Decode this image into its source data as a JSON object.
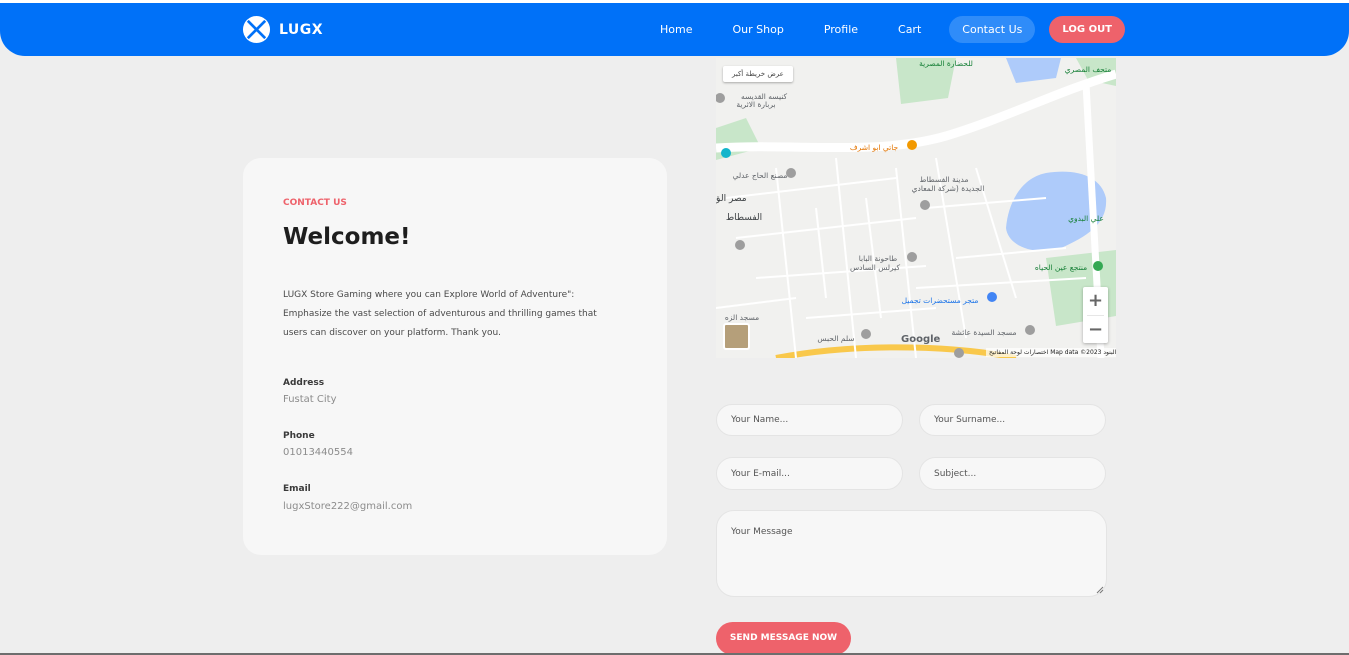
{
  "header": {
    "brand": "LUGX",
    "nav": [
      {
        "label": "Home"
      },
      {
        "label": "Our Shop"
      },
      {
        "label": "Profile"
      },
      {
        "label": "Cart"
      },
      {
        "label": "Contact Us"
      }
    ],
    "logout_label": "LOG OUT"
  },
  "contact": {
    "eyebrow": "CONTACT US",
    "title": "Welcome!",
    "description": "LUGX Store Gaming where you can Explore World of Adventure\": Emphasize the vast selection of adventurous and thrilling games that users can discover on your platform. Thank you.",
    "address_label": "Address",
    "address_value": "Fustat City",
    "phone_label": "Phone",
    "phone_value": "01013440554",
    "email_label": "Email",
    "email_value": "lugxStore222@gmail.com"
  },
  "map": {
    "view_larger": "عرض خريطة أكبر",
    "zoom_in": "+",
    "zoom_out": "−",
    "google": "Google",
    "credit": "اختصارات لوحة المفاتيح   Map data ©2023   البنود",
    "labels": [
      "مدينة الفسطاط",
      "الجديدة (شركة المعادي",
      "طاحونة البابا",
      "كيرلس السادس",
      "متجر مستحضرات تجميل",
      "مسجد السيدة عائشة",
      "سلم الحبس",
      "جاتي ابو اشرف",
      "مصنع الحاج عدلي",
      "الفسطاط",
      "مصر الق",
      "منتجع عين الحياه",
      "علي البدوي",
      "كنيسه القديسه",
      "بربارة الاثرية",
      "للحضارة المصرية",
      "مسجد الزه",
      "متحف المصري"
    ]
  },
  "form": {
    "name_placeholder": "Your Name...",
    "surname_placeholder": "Your Surname...",
    "email_placeholder": "Your E-mail...",
    "subject_placeholder": "Subject...",
    "message_placeholder": "Your Message",
    "send_label": "SEND MESSAGE NOW"
  }
}
